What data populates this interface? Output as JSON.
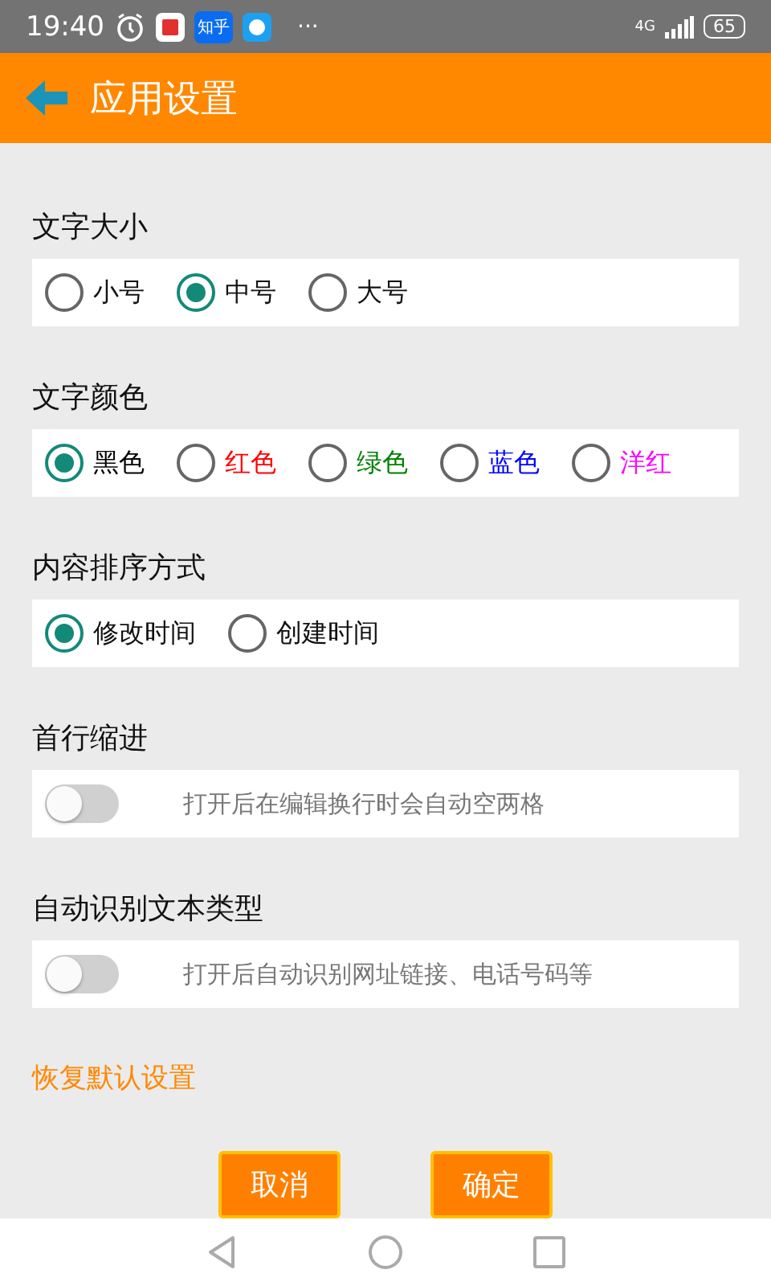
{
  "status_bar": {
    "time": "19:40",
    "app_icon_label": "知乎",
    "more": "···",
    "network": "4G",
    "battery": "65"
  },
  "app_bar": {
    "title": "应用设置"
  },
  "sections": [
    {
      "title": "文字大小",
      "kind": "radio",
      "options": [
        {
          "label": "小号",
          "selected": false
        },
        {
          "label": "中号",
          "selected": true
        },
        {
          "label": "大号",
          "selected": false
        }
      ]
    },
    {
      "title": "文字颜色",
      "kind": "radio",
      "options": [
        {
          "label": "黑色",
          "selected": true,
          "color": "#000000"
        },
        {
          "label": "红色",
          "selected": false,
          "color": "#ff0000"
        },
        {
          "label": "绿色",
          "selected": false,
          "color": "#008000"
        },
        {
          "label": "蓝色",
          "selected": false,
          "color": "#0000ff"
        },
        {
          "label": "洋红",
          "selected": false,
          "color": "#ff00ff"
        }
      ]
    },
    {
      "title": "内容排序方式",
      "kind": "radio",
      "options": [
        {
          "label": "修改时间",
          "selected": true
        },
        {
          "label": "创建时间",
          "selected": false
        }
      ]
    },
    {
      "title": "首行缩进",
      "kind": "switch",
      "on": false,
      "description": "打开后在编辑换行时会自动空两格"
    },
    {
      "title": "自动识别文本类型",
      "kind": "switch",
      "on": false,
      "description": "打开后自动识别网址链接、电话号码等"
    }
  ],
  "reset_link": "恢复默认设置",
  "buttons": [
    "取消",
    "确定"
  ]
}
